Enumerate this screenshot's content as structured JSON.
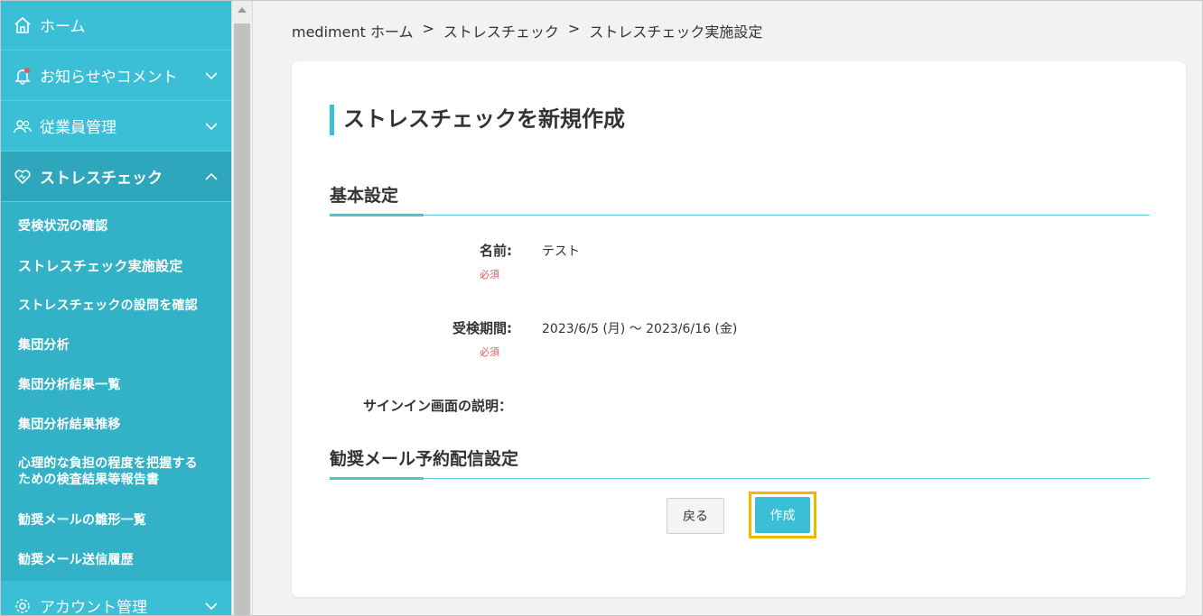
{
  "sidebar": {
    "home": "ホーム",
    "notices": "お知らせやコメント",
    "employees": "従業員管理",
    "stress_check": "ストレスチェック",
    "sub_items": [
      "受検状況の確認",
      "ストレスチェック実施設定",
      "ストレスチェックの設問を確認",
      "集団分析",
      "集団分析結果一覧",
      "集団分析結果推移",
      "心理的な負担の程度を把握するための検査結果等報告書",
      "勧奨メールの雛形一覧",
      "勧奨メール送信履歴"
    ],
    "sub_item_twoline": [
      "心理的な負担の程度を把握する",
      "ための検査結果等報告書"
    ],
    "account": "アカウント管理"
  },
  "breadcrumb": [
    "mediment ホーム",
    "ストレスチェック",
    "ストレスチェック実施設定"
  ],
  "breadcrumb_sep": ">",
  "page_title": "ストレスチェックを新規作成",
  "sections": {
    "basic": "基本設定",
    "email": "勧奨メール予約配信設定"
  },
  "fields": {
    "name_label": "名前:",
    "name_required": "必須",
    "name_value": "テスト",
    "period_label": "受検期間:",
    "period_required": "必須",
    "period_value": "2023/6/5 (月) 〜 2023/6/16 (金)",
    "signin_label": "サインイン画面の説明："
  },
  "buttons": {
    "back": "戻る",
    "create": "作成"
  },
  "colors": {
    "accent": "#3bbfd6",
    "highlight": "#f5b400",
    "required": "#e05a5a"
  }
}
